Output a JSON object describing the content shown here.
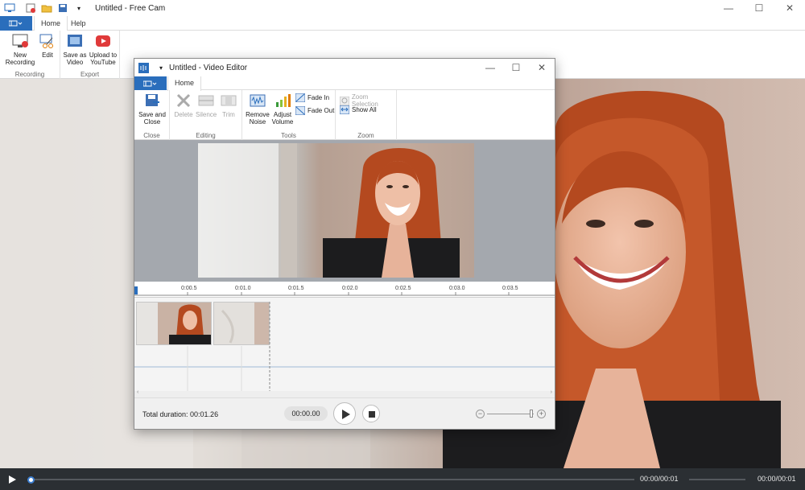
{
  "main": {
    "title": "Untitled - Free Cam",
    "tabs": [
      "Home",
      "Help"
    ],
    "ribbon": {
      "recording": {
        "label": "Recording",
        "new_recording": "New Recording",
        "edit": "Edit"
      },
      "export": {
        "label": "Export",
        "save_as_video": "Save as Video",
        "upload": "Upload to YouTube"
      }
    }
  },
  "editor": {
    "title": "Untitled - Video Editor",
    "tab": "Home",
    "ribbon": {
      "close_group": {
        "label": "Close",
        "save_close": "Save and Close"
      },
      "editing_group": {
        "label": "Editing",
        "delete": "Delete",
        "silence": "Silence",
        "trim": "Trim"
      },
      "tools_group": {
        "label": "Tools",
        "remove_noise": "Remove Noise",
        "adjust_volume": "Adjust Volume",
        "fade_in": "Fade In",
        "fade_out": "Fade Out"
      },
      "zoom_group": {
        "label": "Zoom",
        "zoom_selection": "Zoom Selection",
        "show_all": "Show All"
      }
    },
    "ruler_ticks": [
      "0:00.5",
      "0:01.0",
      "0:01.5",
      "0:02.0",
      "0:02.5",
      "0:03.0",
      "0:03.5"
    ],
    "total_duration": "Total duration: 00:01.26",
    "current_time": "00:00.00"
  },
  "player": {
    "time_left": "00:00/00:01",
    "time_right": "00:00/00:01",
    "progress": 0.0
  },
  "colors": {
    "accent": "#2a6ebc",
    "player_bg": "#2b2f33"
  }
}
